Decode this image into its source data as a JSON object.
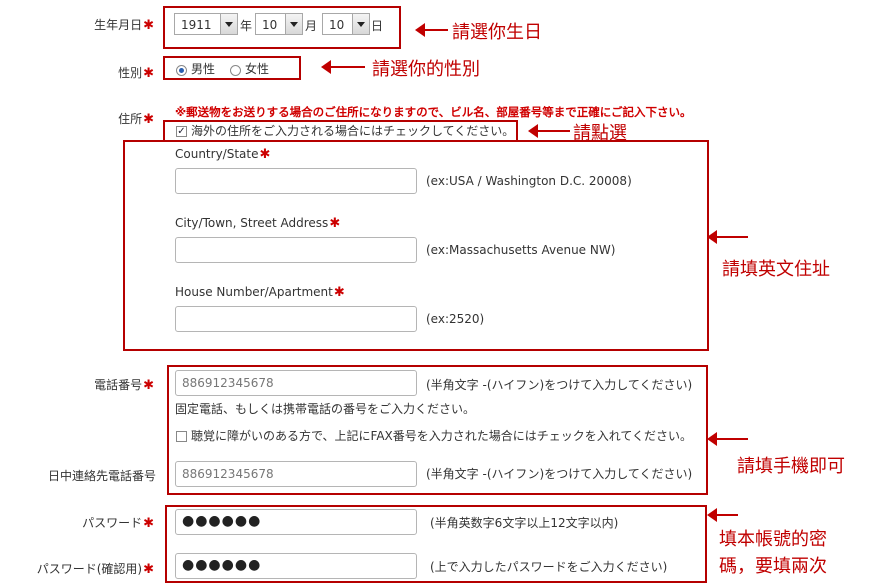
{
  "birthday": {
    "label": "生年月日",
    "year": "1911",
    "year_unit": "年",
    "month": "10",
    "month_unit": "月",
    "day": "10",
    "day_unit": "日",
    "annotation": "請選你生日"
  },
  "gender": {
    "label": "性別",
    "male": "男性",
    "female": "女性",
    "annotation": "請選你的性別"
  },
  "address": {
    "label": "住所",
    "notice": "※郵送物をお送りする場合のご住所になりますので、ビル名、部屋番号等まで正確にご記入下さい。",
    "overseas_checkbox": "海外の住所をご入力される場合にはチェックしてください。",
    "checkbox_annotation": "請點選",
    "country_label": "Country/State",
    "country_hint": "(ex:USA / Washington D.C. 20008)",
    "city_label": "City/Town, Street Address",
    "city_hint": "(ex:Massachusetts Avenue NW)",
    "house_label": "House Number/Apartment",
    "house_hint": "(ex:2520)",
    "annotation": "請填英文住址"
  },
  "phone": {
    "label": "電話番号",
    "value": "886912345678",
    "hint": "(半角文字 -(ハイフン)をつけて入力してください)",
    "note": "固定電話、もしくは携帯電話の番号をご入力ください。",
    "fax_checkbox": "聴覚に障がいのある方で、上記にFAX番号を入力された場合にはチェックを入れてください。",
    "day_label": "日中連絡先電話番号",
    "day_value": "886912345678",
    "day_hint": "(半角文字 -(ハイフン)をつけて入力してください)",
    "annotation": "請填手機即可"
  },
  "password": {
    "label": "パスワード",
    "value": "●●●●●●",
    "hint": "(半角英数字6文字以上12文字以内)",
    "confirm_label": "パスワード(確認用)",
    "confirm_value": "●●●●●●",
    "confirm_hint": "(上で入力したパスワードをご入力ください)",
    "annotation_line1": "填本帳號的密",
    "annotation_line2": "碼，要填兩次"
  },
  "required_mark": "✱",
  "colors": {
    "annotation_red": "#c00000",
    "required_red": "#cc0000"
  }
}
